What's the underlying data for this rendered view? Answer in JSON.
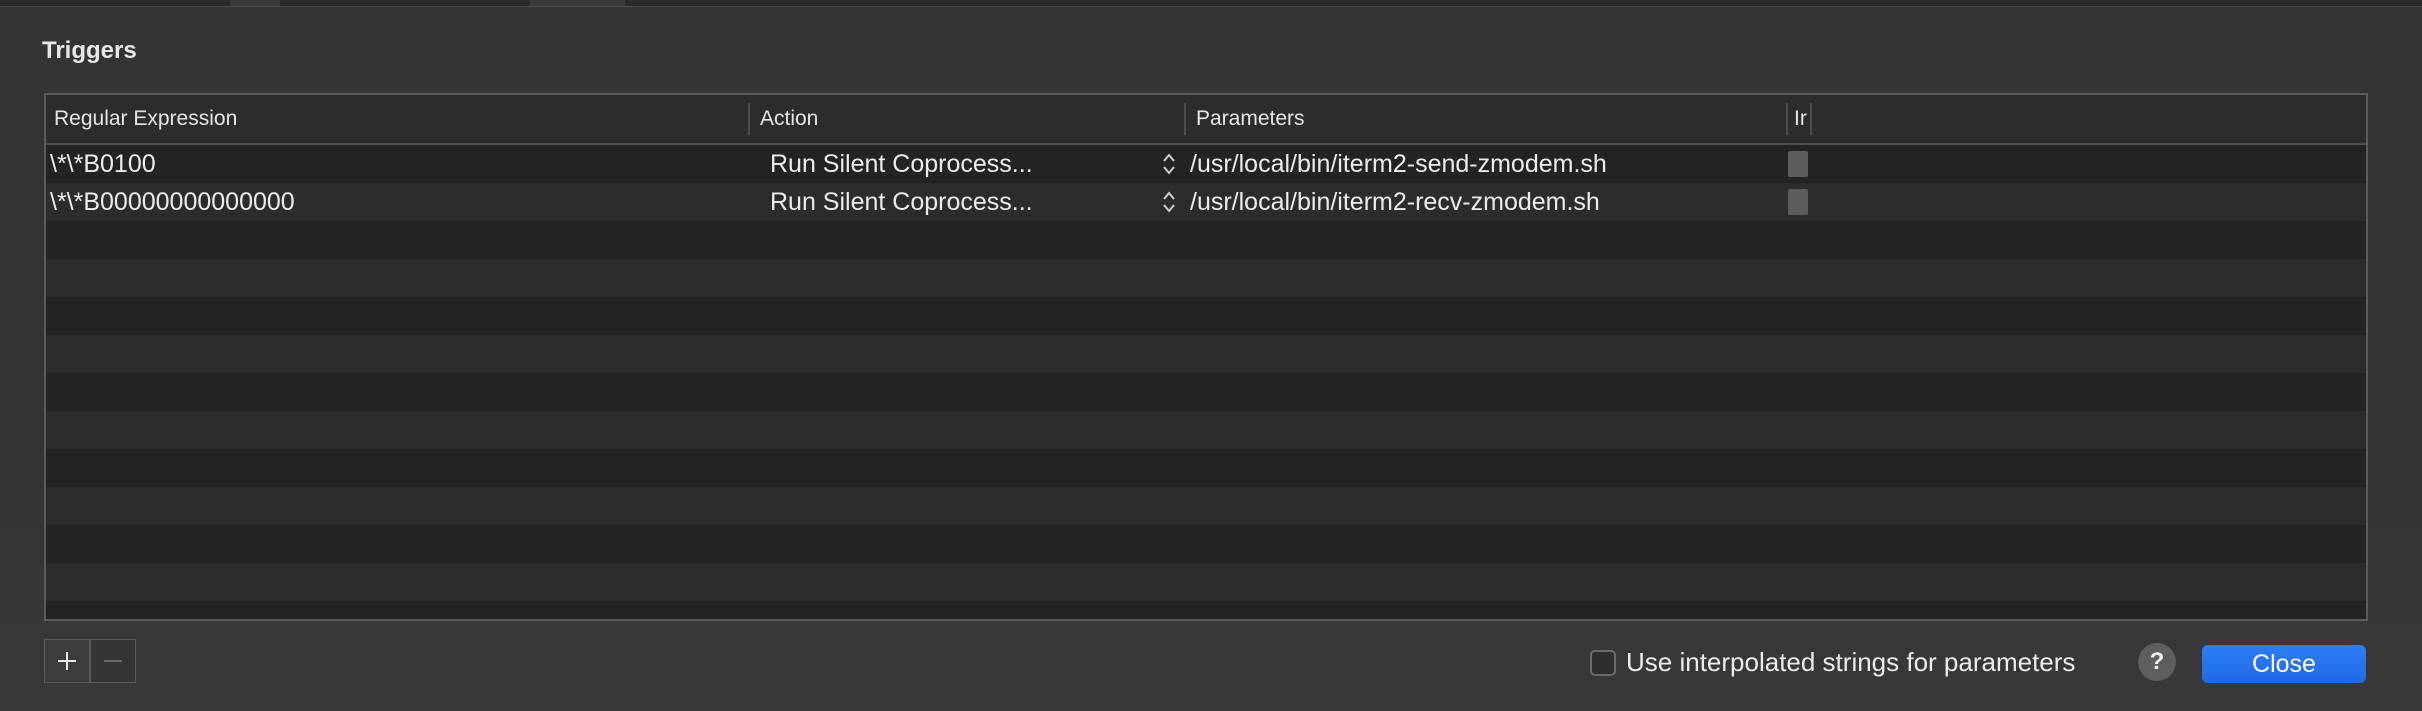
{
  "dialog": {
    "title": "Triggers"
  },
  "table": {
    "columns": [
      {
        "label": "Regular Expression"
      },
      {
        "label": "Action"
      },
      {
        "label": "Parameters"
      },
      {
        "label": "Ir"
      }
    ],
    "rows": [
      {
        "regex": "\\*\\*B0100",
        "action": "Run Silent Coprocess...",
        "parameters": "/usr/local/bin/iterm2-send-zmodem.sh",
        "checked": false
      },
      {
        "regex": "\\*\\*B00000000000000",
        "action": "Run Silent Coprocess...",
        "parameters": "/usr/local/bin/iterm2-recv-zmodem.sh",
        "checked": false
      }
    ]
  },
  "footer": {
    "add_label": "+",
    "remove_label": "−",
    "interpolate_label": "Use interpolated strings for parameters",
    "interpolate_checked": false,
    "help_label": "?",
    "close_label": "Close"
  },
  "colors": {
    "accent": "#2576f0"
  }
}
